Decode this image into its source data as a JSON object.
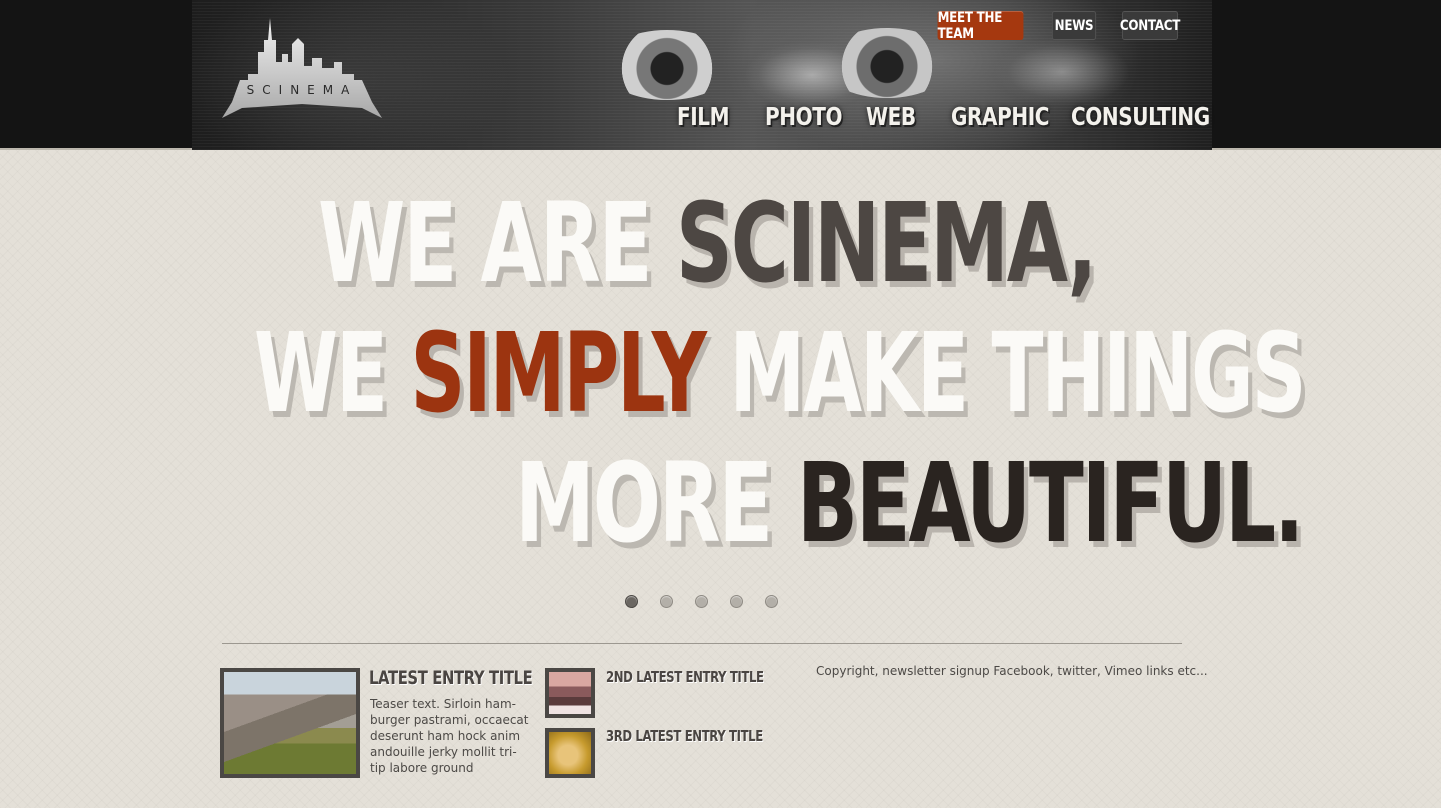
{
  "header": {
    "logo_text": "SCINEMA",
    "top_buttons": {
      "meet_the_team": "MEET THE TEAM",
      "news": "NEWS",
      "contact": "CONTACT"
    },
    "nav": [
      "FILM",
      "PHOTO",
      "WEB",
      "GRAPHIC",
      "CONSULTING"
    ],
    "colors": {
      "accent": "#a5380f",
      "button_dark": "#3a3a3a",
      "bar": "#141414"
    }
  },
  "hero": {
    "line1": [
      "WE ARE ",
      "SCINEMA,"
    ],
    "line2": [
      "WE ",
      "SIMPLY",
      " MAKE THINGS"
    ],
    "line3": [
      "MORE ",
      "BEAUTIFUL."
    ],
    "slides": {
      "count": 5,
      "active": 1
    },
    "colors": {
      "white": "#fbfaf7",
      "gray": "#4d4743",
      "orange": "#9c3410",
      "black": "#2a2420"
    }
  },
  "entries": {
    "latest": {
      "title": "LATEST ENTRY TITLE",
      "teaser": "Teaser text. Sirloin ham-burger pastrami, occaecat deserunt ham hock anim andouille jerky mollit tri-tip labore ground"
    },
    "second": {
      "title": "2ND LATEST ENTRY TITLE"
    },
    "third": {
      "title": "3RD LATEST ENTRY TITLE"
    }
  },
  "footer": {
    "copyright": "Copyright, newsletter signup Facebook, twitter, Vimeo links etc..."
  }
}
